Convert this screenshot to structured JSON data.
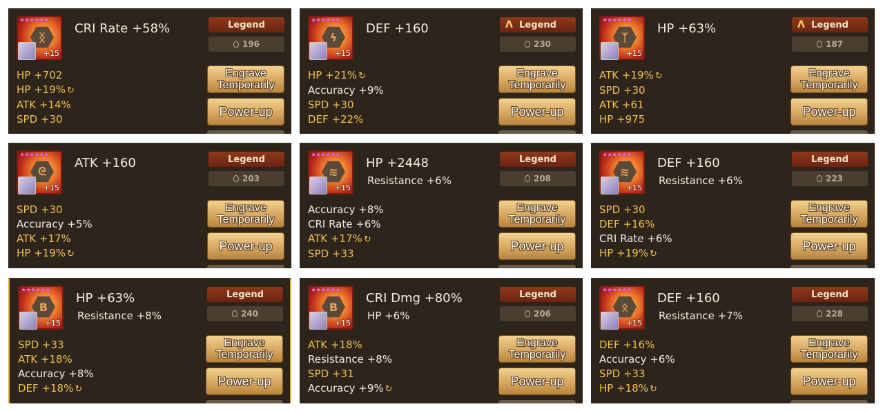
{
  "labels": {
    "legend": "Legend",
    "engrave_line1": "Engrave",
    "engrave_line2": "Temporarily",
    "power_up": "Power-up",
    "stars": "★★★★★★"
  },
  "runes": [
    {
      "main": "CRI Rate +58%",
      "innate": "",
      "level": "+15",
      "price": "196",
      "accent": false,
      "symbol": "ᛝ",
      "subs": [
        {
          "name": "HP",
          "value": "+702",
          "name_white": false,
          "regen": false
        },
        {
          "name": "HP",
          "value": "+19%",
          "name_white": false,
          "regen": true
        },
        {
          "name": "ATK",
          "value": "+14%",
          "name_white": false,
          "regen": false
        },
        {
          "name": "SPD",
          "value": "+30",
          "name_white": false,
          "regen": false
        }
      ]
    },
    {
      "main": "DEF +160",
      "innate": "",
      "level": "+15",
      "price": "230",
      "accent": true,
      "symbol": "ϟ",
      "subs": [
        {
          "name": "HP",
          "value": "+21%",
          "name_white": false,
          "regen": true
        },
        {
          "name": "Accuracy",
          "value": "+9%",
          "name_white": true,
          "regen": false
        },
        {
          "name": "SPD",
          "value": "+30",
          "name_white": false,
          "regen": false
        },
        {
          "name": "DEF",
          "value": "+22%",
          "name_white": false,
          "regen": false
        }
      ]
    },
    {
      "main": "HP +63%",
      "innate": "",
      "level": "+15",
      "price": "187",
      "accent": true,
      "symbol": "ᛉ",
      "subs": [
        {
          "name": "ATK",
          "value": "+19%",
          "name_white": false,
          "regen": true
        },
        {
          "name": "SPD",
          "value": "+30",
          "name_white": false,
          "regen": false
        },
        {
          "name": "ATK",
          "value": "+61",
          "name_white": false,
          "regen": false
        },
        {
          "name": "HP",
          "value": "+975",
          "name_white": false,
          "regen": false
        }
      ]
    },
    {
      "main": "ATK +160",
      "innate": "",
      "level": "+15",
      "price": "203",
      "accent": false,
      "symbol": "ᘓ",
      "subs": [
        {
          "name": "SPD",
          "value": "+30",
          "name_white": false,
          "regen": false
        },
        {
          "name": "Accuracy",
          "value": "+5%",
          "name_white": true,
          "regen": false
        },
        {
          "name": "ATK",
          "value": "+17%",
          "name_white": false,
          "regen": false
        },
        {
          "name": "HP",
          "value": "+19%",
          "name_white": false,
          "regen": true
        }
      ]
    },
    {
      "main": "HP +2448",
      "innate": "Resistance +6%",
      "level": "+15",
      "price": "208",
      "accent": false,
      "symbol": "≋",
      "subs": [
        {
          "name": "Accuracy",
          "value": "+8%",
          "name_white": true,
          "regen": false
        },
        {
          "name": "CRI Rate",
          "value": "+6%",
          "name_white": true,
          "regen": false
        },
        {
          "name": "ATK",
          "value": "+17%",
          "name_white": false,
          "regen": true
        },
        {
          "name": "SPD",
          "value": "+33",
          "name_white": false,
          "regen": false
        }
      ]
    },
    {
      "main": "DEF +160",
      "innate": "Resistance +6%",
      "level": "+15",
      "price": "223",
      "accent": false,
      "symbol": "≋",
      "subs": [
        {
          "name": "SPD",
          "value": "+30",
          "name_white": false,
          "regen": false
        },
        {
          "name": "DEF",
          "value": "+16%",
          "name_white": false,
          "regen": false
        },
        {
          "name": "CRI Rate",
          "value": "+6%",
          "name_white": true,
          "regen": false
        },
        {
          "name": "HP",
          "value": "+19%",
          "name_white": false,
          "regen": true
        }
      ]
    },
    {
      "main": "HP +63%",
      "innate": "Resistance +8%",
      "level": "+15",
      "price": "240",
      "accent": false,
      "symbol": "B",
      "subs": [
        {
          "name": "SPD",
          "value": "+33",
          "name_white": false,
          "regen": false
        },
        {
          "name": "ATK",
          "value": "+18%",
          "name_white": false,
          "regen": false
        },
        {
          "name": "Accuracy",
          "value": "+8%",
          "name_white": true,
          "regen": false
        },
        {
          "name": "DEF",
          "value": "+18%",
          "name_white": false,
          "regen": true
        }
      ]
    },
    {
      "main": "CRI Dmg +80%",
      "innate": "HP +6%",
      "level": "+15",
      "price": "206",
      "accent": false,
      "symbol": "B",
      "subs": [
        {
          "name": "ATK",
          "value": "+18%",
          "name_white": false,
          "regen": false
        },
        {
          "name": "Resistance",
          "value": "+8%",
          "name_white": true,
          "regen": false
        },
        {
          "name": "SPD",
          "value": "+31",
          "name_white": false,
          "regen": false
        },
        {
          "name": "Accuracy",
          "value": "+9%",
          "name_white": true,
          "regen": true
        }
      ]
    },
    {
      "main": "DEF +160",
      "innate": "Resistance +7%",
      "level": "+15",
      "price": "228",
      "accent": false,
      "symbol": "ᛟ",
      "subs": [
        {
          "name": "DEF",
          "value": "+16%",
          "name_white": false,
          "regen": false
        },
        {
          "name": "Accuracy",
          "value": "+6%",
          "name_white": true,
          "regen": false
        },
        {
          "name": "SPD",
          "value": "+33",
          "name_white": false,
          "regen": false
        },
        {
          "name": "HP",
          "value": "+18%",
          "name_white": false,
          "regen": true
        }
      ]
    }
  ]
}
